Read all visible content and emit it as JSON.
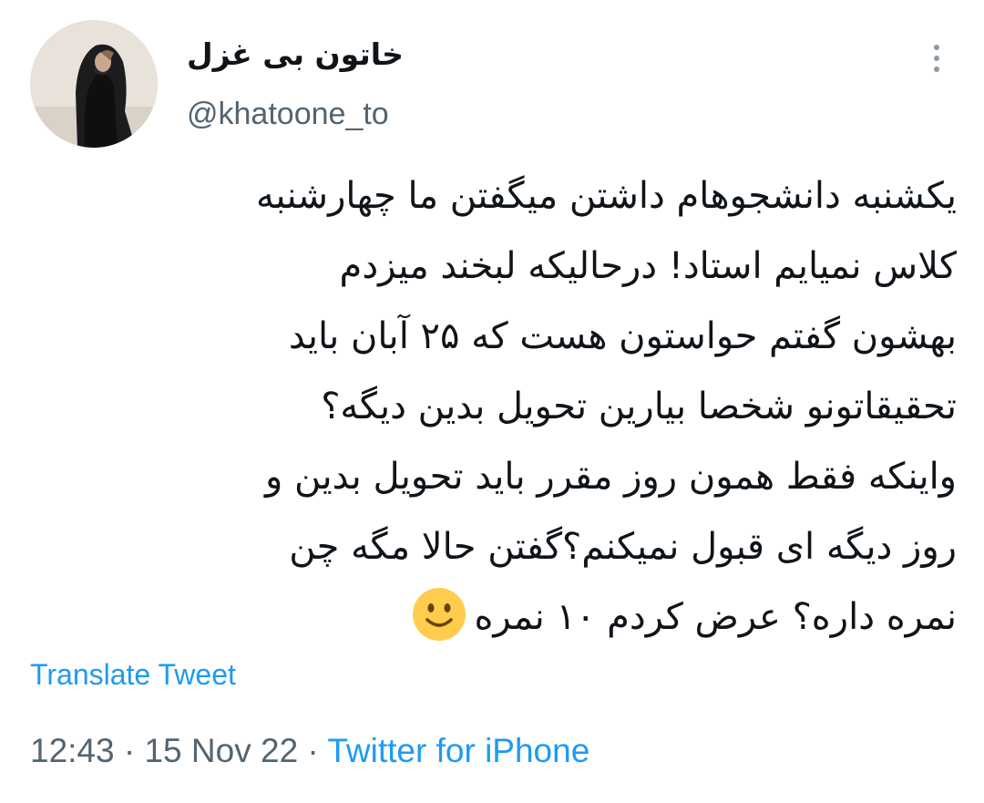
{
  "author": {
    "display_name": "خاتون بی غزل",
    "handle": "@khatoone_to",
    "avatar_icon": "profile-photo-hijab-woman"
  },
  "tweet": {
    "lines": [
      "یکشنبه دانشجوهام داشتن میگفتن ما چهارشنبه",
      "کلاس نمیایم استاد! درحالیکه لبخند میزدم",
      "بهشون گفتم حواستون هست که ۲۵ آبان باید",
      "تحقیقاتونو شخصا بیارین تحویل بدین دیگه؟",
      "واینکه فقط همون روز مقرر باید تحویل بدین و",
      "روز دیگه ای قبول نمیکنم؟گفتن حالا مگه چن",
      "نمره داره؟ عرض کردم ۱۰ نمره"
    ],
    "trailing_emoji": "slightly-smiling-face",
    "translate_label": "Translate Tweet"
  },
  "meta": {
    "time": "12:43",
    "separator_1": " · ",
    "date": "15 Nov 22",
    "separator_2": " · ",
    "source": "Twitter for iPhone"
  },
  "colors": {
    "text": "#0f1419",
    "secondary": "#536471",
    "link": "#1d9bf0"
  },
  "icons": {
    "more": "more-vertical-dots-icon"
  }
}
